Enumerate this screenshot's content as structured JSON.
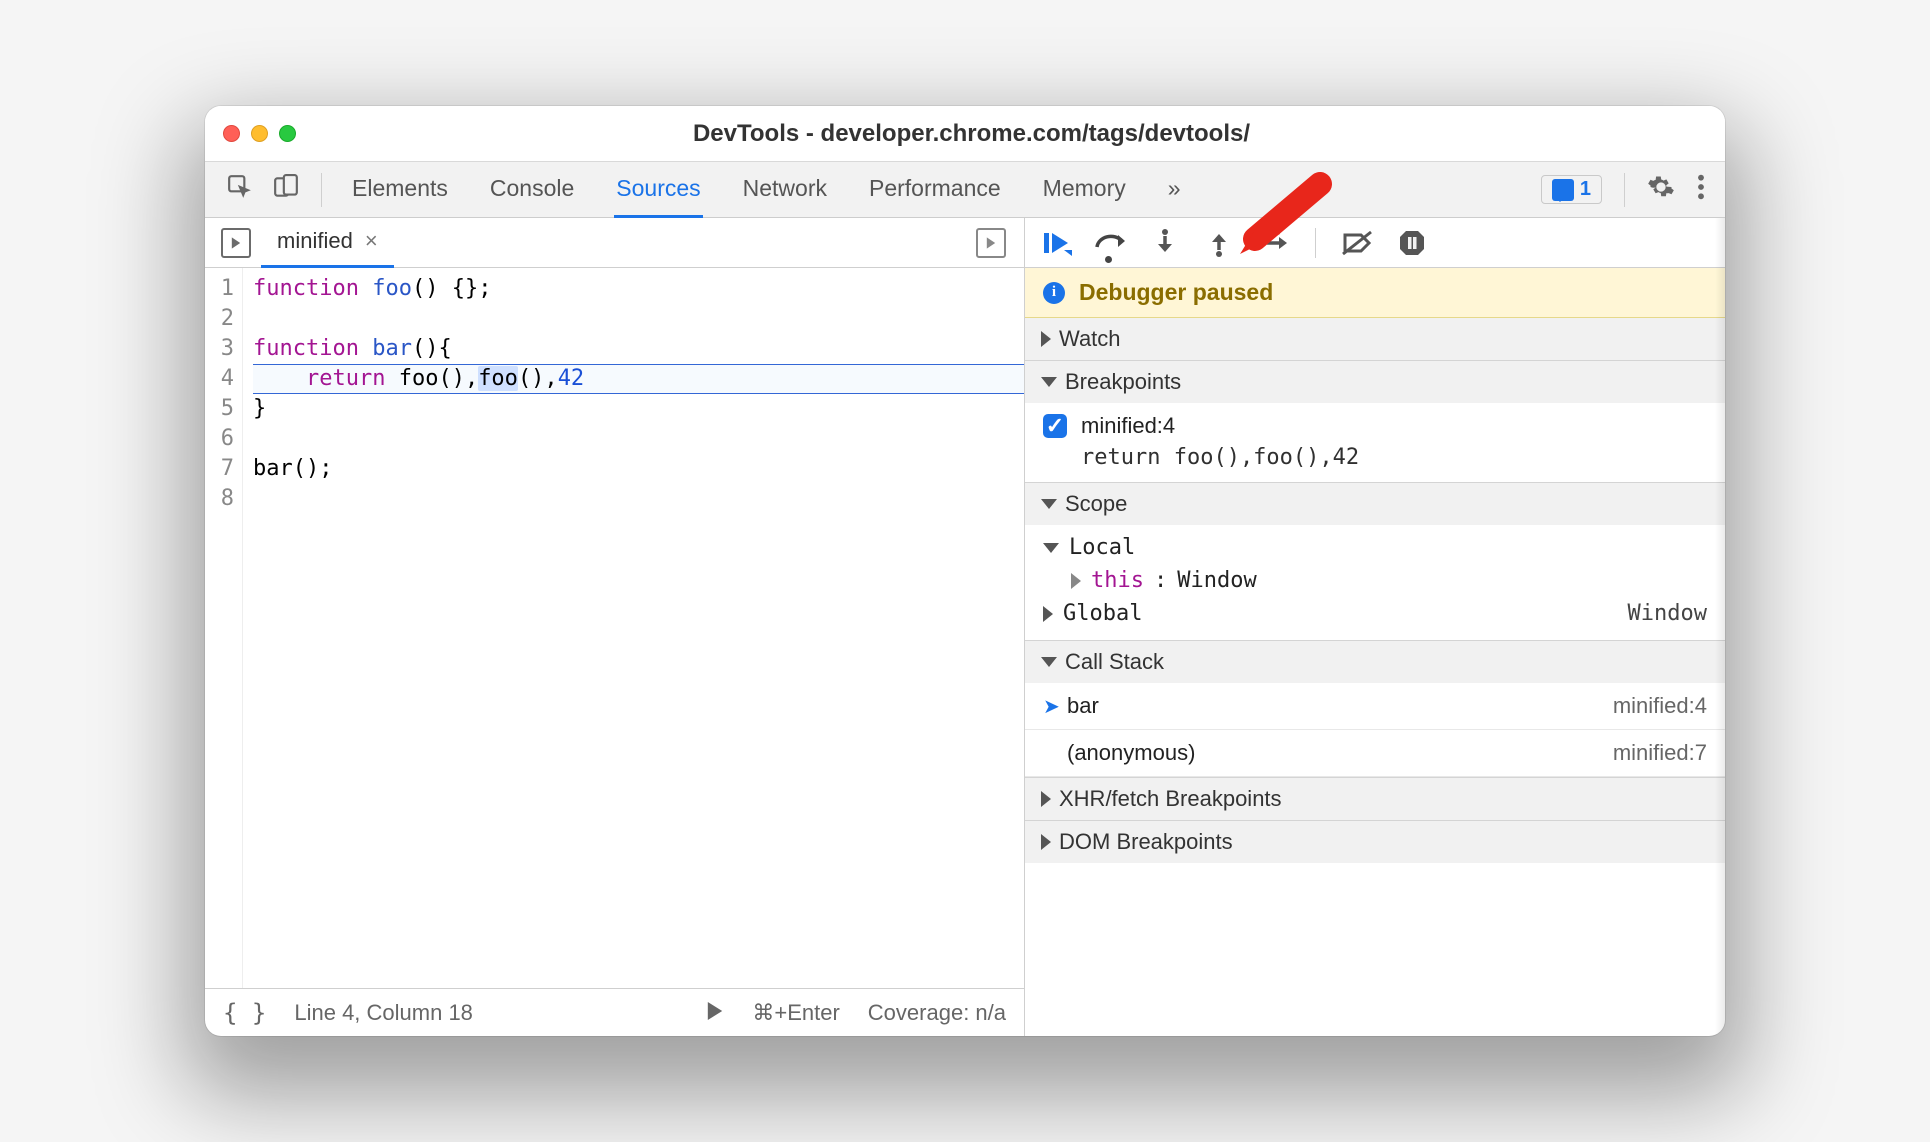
{
  "window_title": "DevTools - developer.chrome.com/tags/devtools/",
  "tabs": [
    "Elements",
    "Console",
    "Sources",
    "Network",
    "Performance",
    "Memory"
  ],
  "active_tab": "Sources",
  "issues_count": "1",
  "file_tab": "minified",
  "code": {
    "lines": [
      {
        "n": "1",
        "segs": [
          {
            "t": "function ",
            "c": "kw"
          },
          {
            "t": "foo",
            "c": "fn"
          },
          {
            "t": "() {};",
            "c": ""
          }
        ]
      },
      {
        "n": "2",
        "segs": []
      },
      {
        "n": "3",
        "segs": [
          {
            "t": "function ",
            "c": "kw"
          },
          {
            "t": "bar",
            "c": "fn"
          },
          {
            "t": "(){",
            "c": ""
          }
        ]
      },
      {
        "n": "4",
        "segs": [
          {
            "t": "    ",
            "c": ""
          },
          {
            "t": "return",
            "c": "ret"
          },
          {
            "t": " foo(),",
            "c": ""
          },
          {
            "t": "foo",
            "c": "hlword"
          },
          {
            "t": "(),",
            "c": ""
          },
          {
            "t": "42",
            "c": "num"
          }
        ]
      },
      {
        "n": "5",
        "segs": [
          {
            "t": "}",
            "c": ""
          }
        ]
      },
      {
        "n": "6",
        "segs": []
      },
      {
        "n": "7",
        "segs": [
          {
            "t": "bar();",
            "c": ""
          }
        ]
      },
      {
        "n": "8",
        "segs": []
      }
    ],
    "highlight_line_index": 3
  },
  "status": {
    "line_col": "Line 4, Column 18",
    "run_hint": "⌘+Enter",
    "coverage": "Coverage: n/a"
  },
  "debugger_paused": "Debugger paused",
  "panels": {
    "watch": "Watch",
    "breakpoints": {
      "title": "Breakpoints",
      "item_label": "minified:4",
      "item_code": "return foo(),foo(),42",
      "checked": true
    },
    "scope": {
      "title": "Scope",
      "local_label": "Local",
      "this_label": "this",
      "this_value": "Window",
      "global_label": "Global",
      "global_value": "Window"
    },
    "callstack": {
      "title": "Call Stack",
      "frames": [
        {
          "name": "bar",
          "loc": "minified:4",
          "current": true
        },
        {
          "name": "(anonymous)",
          "loc": "minified:7",
          "current": false
        }
      ]
    },
    "xhr": "XHR/fetch Breakpoints",
    "dom": "DOM Breakpoints"
  }
}
